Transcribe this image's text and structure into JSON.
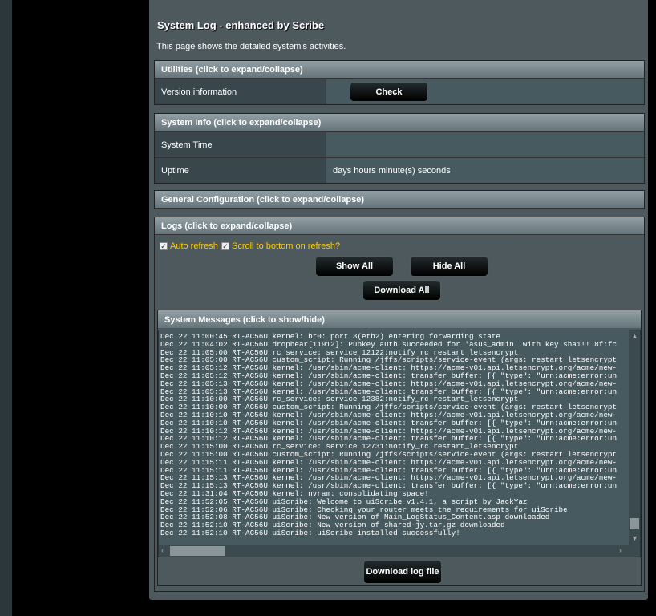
{
  "header": {
    "title": "System Log - enhanced by Scribe",
    "description": "This page shows the detailed system's activities."
  },
  "utilities": {
    "title": "Utilities (click to expand/collapse)",
    "version_label": "Version information",
    "check_label": "Check"
  },
  "sysinfo": {
    "title": "System Info (click to expand/collapse)",
    "time_label": "System Time",
    "time_value": "",
    "uptime_label": "Uptime",
    "uptime_value": "days hours minute(s) seconds"
  },
  "general": {
    "title": "General Configuration (click to expand/collapse)"
  },
  "logs": {
    "title": "Logs (click to expand/collapse)",
    "auto_refresh": "Auto refresh",
    "auto_refresh_checked": true,
    "scroll_bottom": "Scroll to bottom on refresh?",
    "scroll_bottom_checked": true,
    "show_all": "Show All",
    "hide_all": "Hide All",
    "download_all": "Download All"
  },
  "messages": {
    "title": "System Messages (click to show/hide)",
    "download_log": "Download log file",
    "lines": [
      "Dec 22 11:00:45 RT-AC56U kernel: br0: port 3(eth2) entering forwarding state",
      "Dec 22 11:04:02 RT-AC56U dropbear[11912]: Pubkey auth succeeded for 'asus_admin' with key sha1!! 8f:fc",
      "Dec 22 11:05:00 RT-AC56U rc_service: service 12122:notify_rc restart_letsencrypt",
      "Dec 22 11:05:00 RT-AC56U custom_script: Running /jffs/scripts/service-event (args: restart letsencrypt",
      "Dec 22 11:05:12 RT-AC56U kernel: /usr/sbin/acme-client: https://acme-v01.api.letsencrypt.org/acme/new-",
      "Dec 22 11:05:12 RT-AC56U kernel: /usr/sbin/acme-client: transfer buffer: [{ \"type\": \"urn:acme:error:un",
      "Dec 22 11:05:13 RT-AC56U kernel: /usr/sbin/acme-client: https://acme-v01.api.letsencrypt.org/acme/new-",
      "Dec 22 11:05:13 RT-AC56U kernel: /usr/sbin/acme-client: transfer buffer: [{ \"type\": \"urn:acme:error:un",
      "Dec 22 11:10:00 RT-AC56U rc_service: service 12382:notify_rc restart_letsencrypt",
      "Dec 22 11:10:00 RT-AC56U custom_script: Running /jffs/scripts/service-event (args: restart letsencrypt",
      "Dec 22 11:10:10 RT-AC56U kernel: /usr/sbin/acme-client: https://acme-v01.api.letsencrypt.org/acme/new-",
      "Dec 22 11:10:10 RT-AC56U kernel: /usr/sbin/acme-client: transfer buffer: [{ \"type\": \"urn:acme:error:un",
      "Dec 22 11:10:12 RT-AC56U kernel: /usr/sbin/acme-client: https://acme-v01.api.letsencrypt.org/acme/new-",
      "Dec 22 11:10:12 RT-AC56U kernel: /usr/sbin/acme-client: transfer buffer: [{ \"type\": \"urn:acme:error:un",
      "Dec 22 11:15:00 RT-AC56U rc_service: service 12731:notify_rc restart_letsencrypt",
      "Dec 22 11:15:00 RT-AC56U custom_script: Running /jffs/scripts/service-event (args: restart letsencrypt",
      "Dec 22 11:15:11 RT-AC56U kernel: /usr/sbin/acme-client: https://acme-v01.api.letsencrypt.org/acme/new-",
      "Dec 22 11:15:11 RT-AC56U kernel: /usr/sbin/acme-client: transfer buffer: [{ \"type\": \"urn:acme:error:un",
      "Dec 22 11:15:13 RT-AC56U kernel: /usr/sbin/acme-client: https://acme-v01.api.letsencrypt.org/acme/new-",
      "Dec 22 11:15:13 RT-AC56U kernel: /usr/sbin/acme-client: transfer buffer: [{ \"type\": \"urn:acme:error:un",
      "Dec 22 11:31:04 RT-AC56U kernel: nvram: consolidating space!",
      "Dec 22 11:52:05 RT-AC56U uiScribe: Welcome to uiScribe v1.4.1, a script by JackYaz",
      "Dec 22 11:52:06 RT-AC56U uiScribe: Checking your router meets the requirements for uiScribe",
      "Dec 22 11:52:08 RT-AC56U uiScribe: New version of Main_LogStatus_Content.asp downloaded",
      "Dec 22 11:52:10 RT-AC56U uiScribe: New version of shared-jy.tar.gz downloaded",
      "Dec 22 11:52:10 RT-AC56U uiScribe: uiScribe installed successfully!"
    ]
  }
}
